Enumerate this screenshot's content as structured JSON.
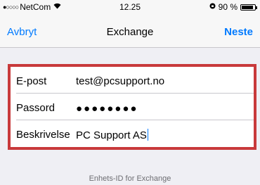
{
  "status_bar": {
    "signal_dots": "●○○○○",
    "carrier": "NetCom",
    "wifi_icon": "wifi-icon",
    "time": "12.25",
    "battery_text": "90 %",
    "battery_level": 0.9
  },
  "nav": {
    "cancel_label": "Avbryt",
    "title": "Exchange",
    "next_label": "Neste"
  },
  "form": {
    "email": {
      "label": "E-post",
      "value": "test@pcsupport.no"
    },
    "password": {
      "label": "Passord",
      "value": "●●●●●●●●"
    },
    "description": {
      "label": "Beskrivelse",
      "value": "PC Support AS"
    }
  },
  "footer": {
    "text": "Enhets-ID for Exchange"
  },
  "colors": {
    "accent": "#007aff",
    "highlight_border": "#c8393b",
    "background": "#efeff4"
  }
}
